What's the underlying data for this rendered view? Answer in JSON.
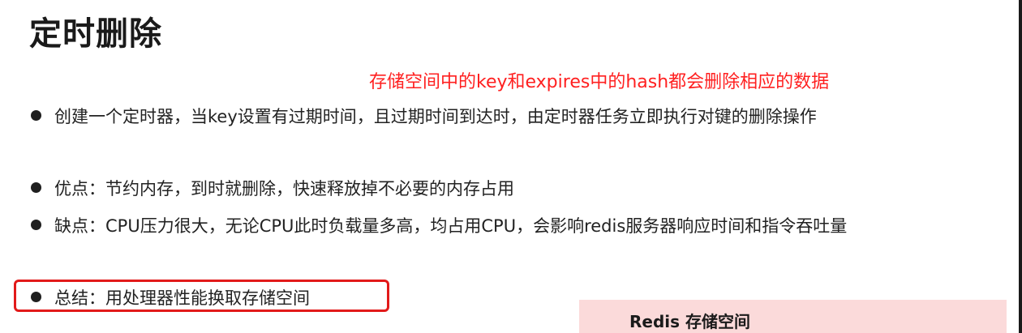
{
  "title": "定时删除",
  "annotation": "存储空间中的key和expires中的hash都会删除相应的数据",
  "bullets": [
    "创建一个定时器，当key设置有过期时间，且过期时间到达时，由定时器任务立即执行对键的删除操作",
    "优点：节约内存，到时就删除，快速释放掉不必要的内存占用",
    "缺点：CPU压力很大，无论CPU此时负载量多高，均占用CPU，会影响redis服务器响应时间和指令吞吐量",
    "总结：用处理器性能换取存储空间"
  ],
  "redis_panel": {
    "label": "Redis 存储空间"
  },
  "colors": {
    "annotation": "#ff2020",
    "highlight_border": "#e21a1a",
    "panel_background": "#fbdada"
  }
}
